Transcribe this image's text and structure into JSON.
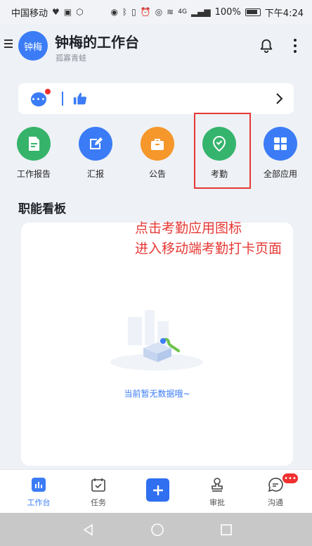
{
  "status_bar": {
    "carrier": "中国移动",
    "network": "4G",
    "battery": "100%",
    "time": "下午4:24"
  },
  "header": {
    "avatar_text": "钟梅",
    "title": "钟梅的工作台",
    "subtitle": "孤寡青蛙"
  },
  "apps": [
    {
      "label": "工作报告",
      "color": "#36b36a",
      "icon": "report-icon"
    },
    {
      "label": "汇报",
      "color": "#3b7cf6",
      "icon": "edit-icon"
    },
    {
      "label": "公告",
      "color": "#f5972b",
      "icon": "bag-icon"
    },
    {
      "label": "考勤",
      "color": "#35b46d",
      "icon": "location-check-icon"
    },
    {
      "label": "全部应用",
      "color": "#3b7cf6",
      "icon": "grid-icon"
    }
  ],
  "board": {
    "title": "职能看板",
    "empty_text": "当前暂无数据哦~"
  },
  "annotation": {
    "line1": "点击考勤应用图标",
    "line2": "进入移动端考勤打卡页面"
  },
  "tabs": [
    {
      "label": "工作台",
      "active": true
    },
    {
      "label": "任务",
      "active": false
    },
    {
      "label": "审批",
      "active": false
    },
    {
      "label": "沟通",
      "active": false
    }
  ],
  "colors": {
    "accent": "#3b7cf6",
    "highlight": "#e53935"
  }
}
